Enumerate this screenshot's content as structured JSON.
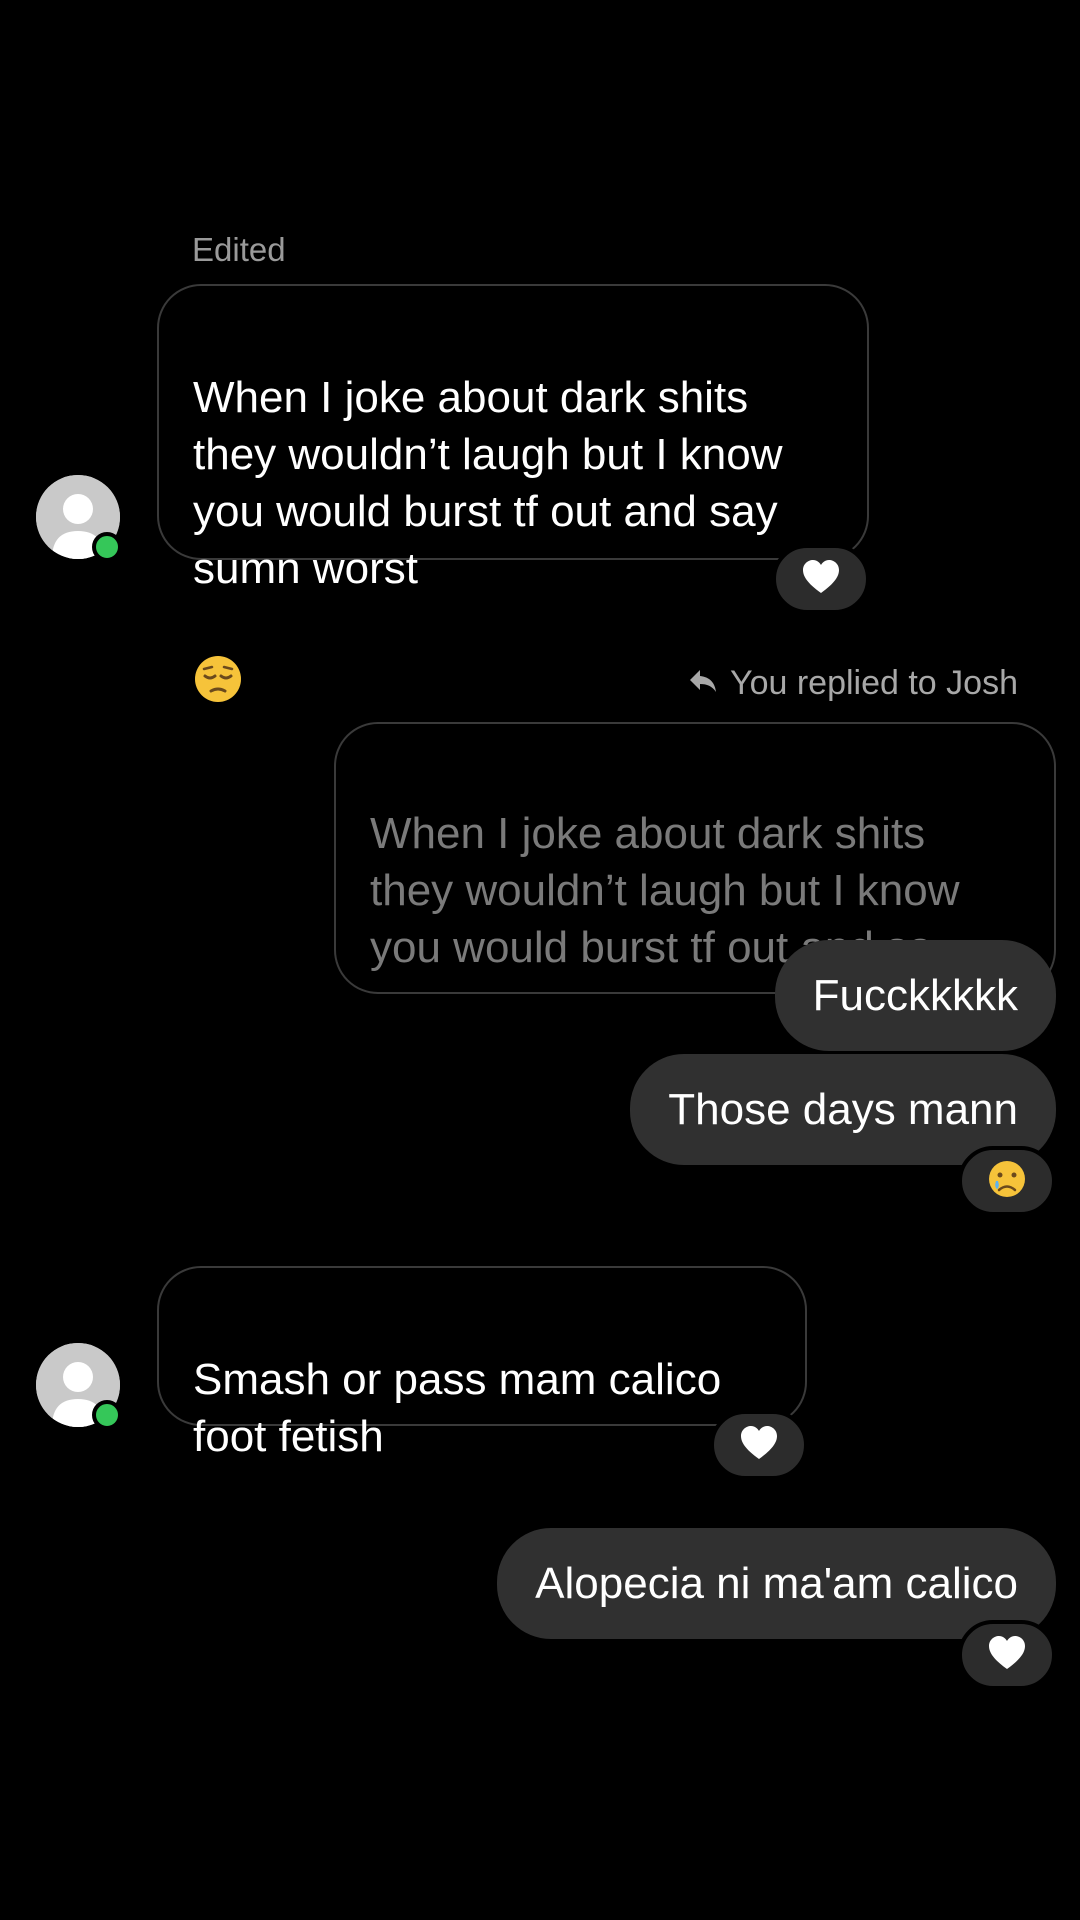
{
  "thread": {
    "edited_label": "Edited",
    "reply_label": "You replied to Josh",
    "messages": [
      {
        "from": "other",
        "text": "When I joke about dark shits\nthey wouldn’t laugh but I know\nyou would burst tf out and say\nsumn worst",
        "emoji": "pensive-face",
        "reaction": "white-heart"
      },
      {
        "from": "me",
        "quoted_text": "When I joke about dark shits\nthey wouldn’t laugh but I know\nyou would burst tf out and sa...",
        "text": "Fucckkkkk"
      },
      {
        "from": "me",
        "text": "Those days mann",
        "reaction": "crying-face"
      },
      {
        "from": "other",
        "text": "Smash or pass mam calico\nfoot fetish",
        "reaction": "white-heart"
      },
      {
        "from": "me",
        "text": "Alopecia ni ma'am calico",
        "reaction": "white-heart"
      }
    ]
  },
  "colors": {
    "background": "#000000",
    "outgoing_bubble": "#303030",
    "incoming_border": "#3a3a3a",
    "online_indicator": "#35c759",
    "reaction_pill": "#2c2c2c"
  }
}
